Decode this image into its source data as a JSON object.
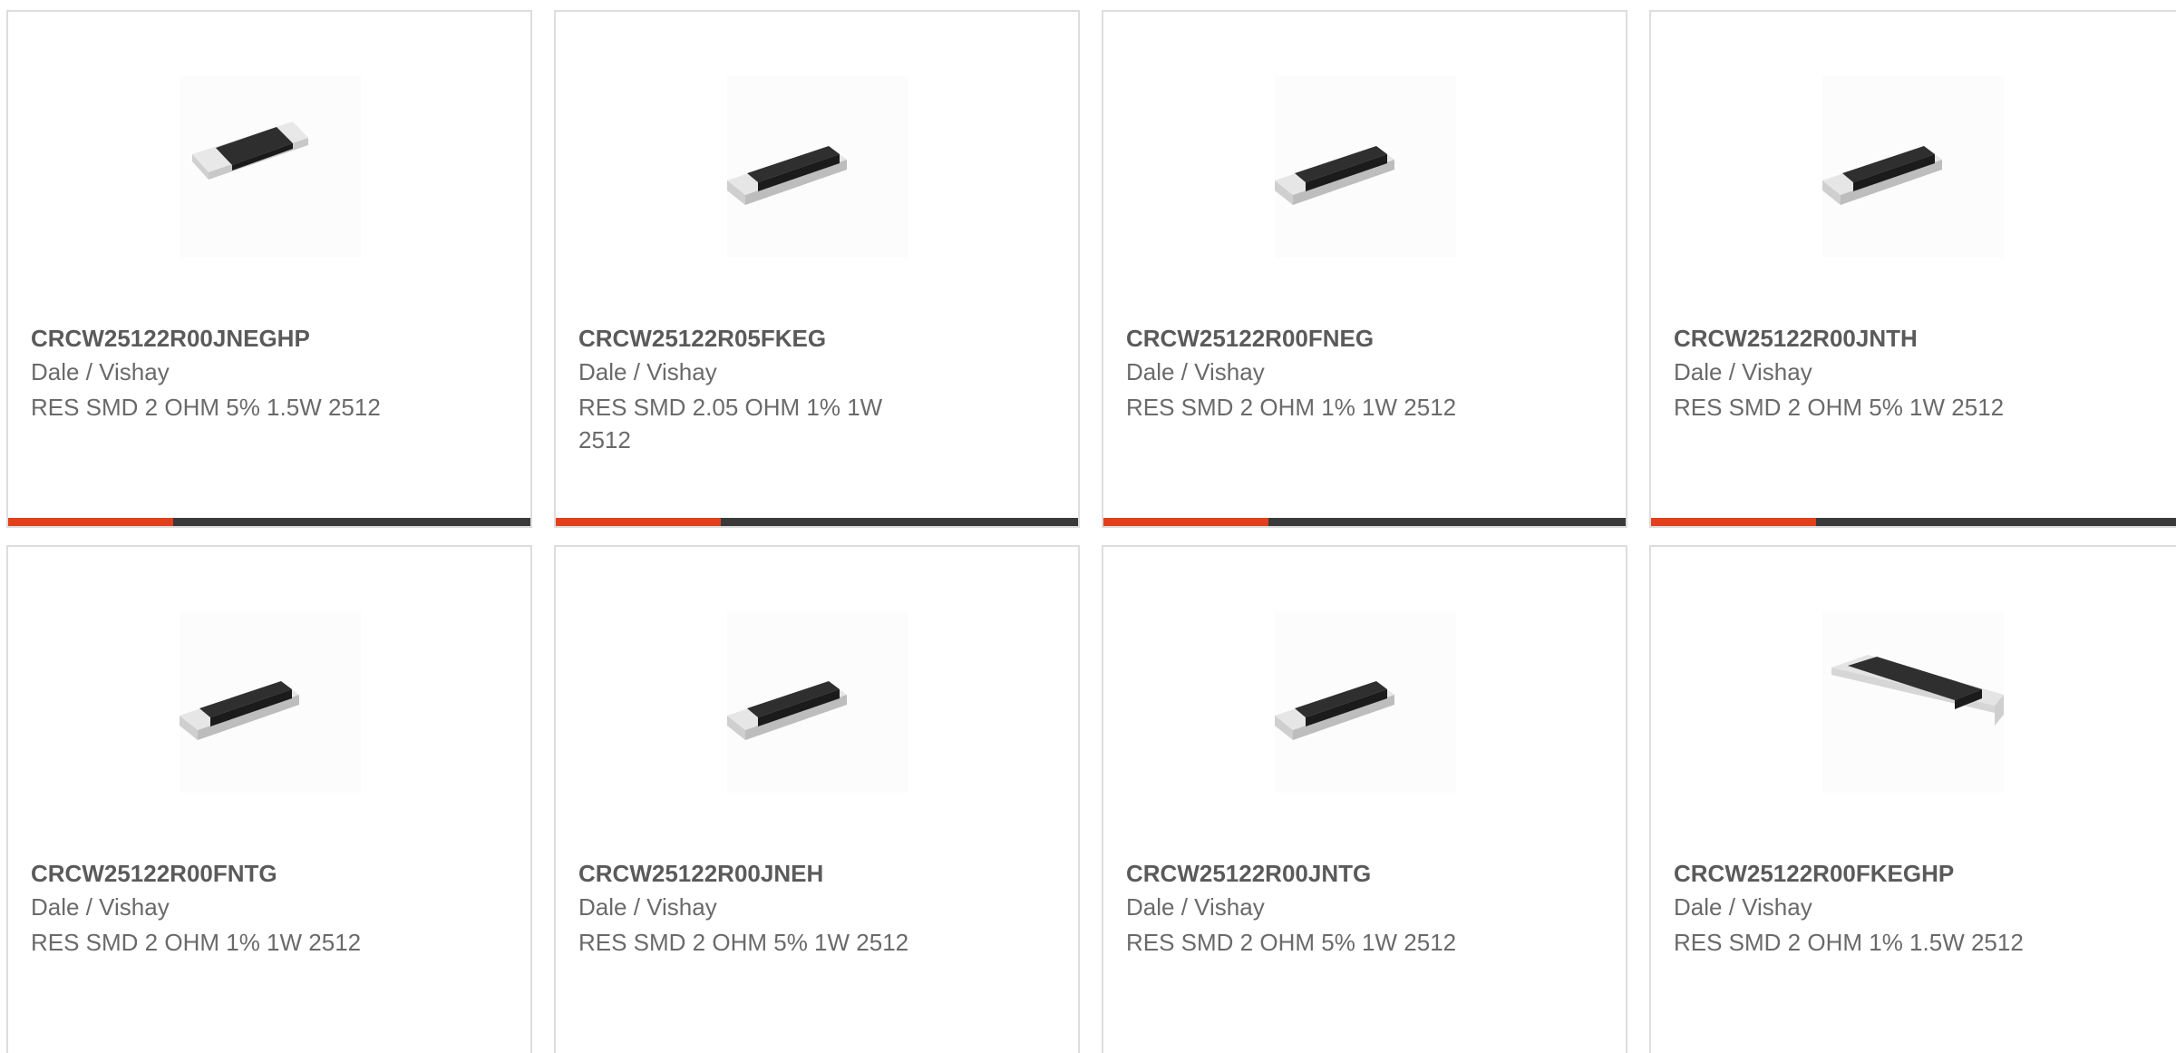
{
  "colors": {
    "accent": "#e2401c",
    "bar": "#3a3a3a",
    "border": "#dddddd",
    "text": "#6a6a6a"
  },
  "products": [
    {
      "part": "CRCW25122R00JNEGHP",
      "mfr": "Dale / Vishay",
      "desc": "RES SMD 2 OHM 5% 1.5W 2512",
      "icon": "resistor-chip-image"
    },
    {
      "part": "CRCW25122R05FKEG",
      "mfr": "Dale / Vishay",
      "desc": "RES SMD 2.05 OHM 1% 1W 2512",
      "icon": "resistor-chip-image"
    },
    {
      "part": "CRCW25122R00FNEG",
      "mfr": "Dale / Vishay",
      "desc": "RES SMD 2 OHM 1% 1W 2512",
      "icon": "resistor-chip-image"
    },
    {
      "part": "CRCW25122R00JNTH",
      "mfr": "Dale / Vishay",
      "desc": "RES SMD 2 OHM 5% 1W 2512",
      "icon": "resistor-chip-image"
    },
    {
      "part": "CRCW25122R00FNTG",
      "mfr": "Dale / Vishay",
      "desc": "RES SMD 2 OHM 1% 1W 2512",
      "icon": "resistor-chip-image"
    },
    {
      "part": "CRCW25122R00JNEH",
      "mfr": "Dale / Vishay",
      "desc": "RES SMD 2 OHM 5% 1W 2512",
      "icon": "resistor-chip-image"
    },
    {
      "part": "CRCW25122R00JNTG",
      "mfr": "Dale / Vishay",
      "desc": "RES SMD 2 OHM 5% 1W 2512",
      "icon": "resistor-chip-image"
    },
    {
      "part": "CRCW25122R00FKEGHP",
      "mfr": "Dale / Vishay",
      "desc": "RES SMD 2 OHM 1% 1.5W 2512",
      "icon": "resistor-chip-image"
    }
  ]
}
